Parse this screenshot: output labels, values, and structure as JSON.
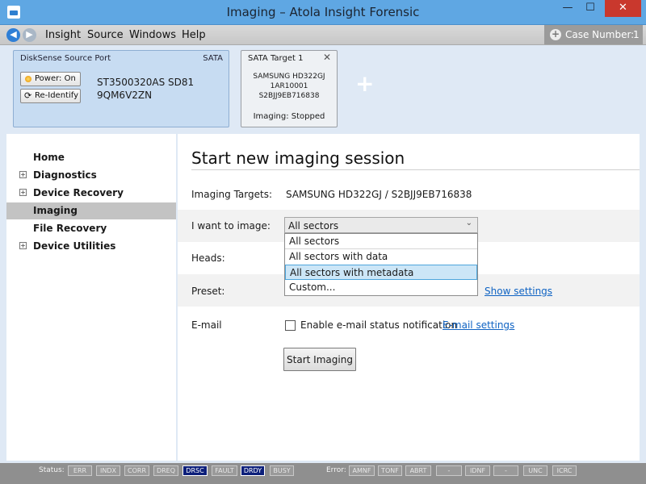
{
  "window": {
    "title": "Imaging – Atola Insight Forensic",
    "minimize_glyph": "—",
    "maximize_glyph": "☐",
    "close_glyph": "✕"
  },
  "menubar": {
    "back_glyph": "◀",
    "forward_glyph": "▶",
    "items": [
      "Insight",
      "Source",
      "Windows",
      "Help"
    ],
    "case_label": "Case Number:",
    "case_value": "1"
  },
  "source": {
    "title": "DiskSense Source Port",
    "port": "SATA",
    "power_label": "Power: On",
    "reidentify_label": "Re-Identify",
    "model": "ST3500320AS SD81",
    "serial": "9QM6V2ZN"
  },
  "target": {
    "title": "SATA Target 1",
    "model": "SAMSUNG HD322GJ",
    "firmware": "1AR10001",
    "serial": "S2BJJ9EB716838",
    "status": "Imaging: Stopped"
  },
  "sidebar": {
    "items": [
      {
        "label": "Home",
        "expandable": false
      },
      {
        "label": "Diagnostics",
        "expandable": true
      },
      {
        "label": "Device Recovery",
        "expandable": true
      },
      {
        "label": "Imaging",
        "expandable": false,
        "active": true
      },
      {
        "label": "File Recovery",
        "expandable": false
      },
      {
        "label": "Device Utilities",
        "expandable": true
      }
    ]
  },
  "main": {
    "title": "Start new imaging session",
    "targets_label": "Imaging Targets:",
    "targets_value": "SAMSUNG HD322GJ / S2BJJ9EB716838",
    "image_label": "I want to image:",
    "image_selected": "All sectors",
    "image_options": [
      "All sectors",
      "All sectors with data",
      "All sectors with metadata",
      "Custom..."
    ],
    "heads_label": "Heads:",
    "preset_label": "Preset:",
    "show_settings": "Show settings",
    "email_label": "E-mail",
    "email_checkbox": "Enable e-mail status notification",
    "email_settings": "E-mail settings",
    "start_button": "Start Imaging"
  },
  "statusbar": {
    "status_label": "Status:",
    "status_indicators": [
      {
        "label": "ERR",
        "on": false
      },
      {
        "label": "INDX",
        "on": false
      },
      {
        "label": "CORR",
        "on": false
      },
      {
        "label": "DREQ",
        "on": false
      },
      {
        "label": "DRSC",
        "on": true
      },
      {
        "label": "FAULT",
        "on": false
      },
      {
        "label": "DRDY",
        "on": true
      },
      {
        "label": "BUSY",
        "on": false
      }
    ],
    "error_label": "Error:",
    "error_indicators": [
      "AMNF",
      "TONF",
      "ABRT",
      "-",
      "IDNF",
      "-",
      "UNC",
      "ICRC"
    ]
  }
}
